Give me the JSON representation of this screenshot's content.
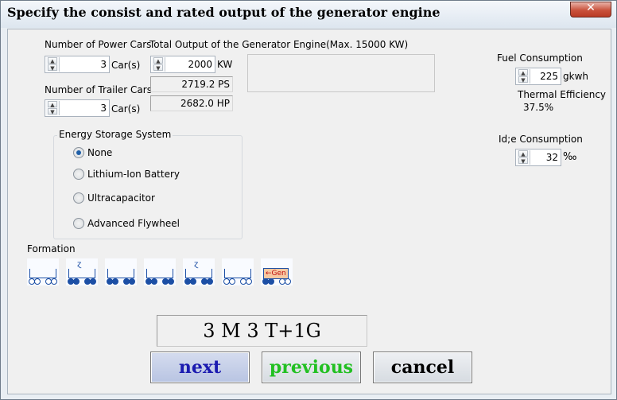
{
  "window": {
    "title": "Specify the consist and rated output of the generator engine",
    "close_glyph": "✕"
  },
  "power_cars": {
    "label": "Number of Power Cars",
    "value": "3",
    "unit": "Car(s)"
  },
  "trailer_cars": {
    "label": "Number of Trailer Cars",
    "value": "3",
    "unit": "Car(s)"
  },
  "total_output": {
    "label": "Total Output of the Generator Engine(Max. 15000 KW)",
    "value": "2000",
    "unit": "KW",
    "ps_value": "2719.2 PS",
    "hp_value": "2682.0 HP"
  },
  "fuel": {
    "label": "Fuel Consumption",
    "value": "225",
    "unit": "gkwh"
  },
  "thermal": {
    "label": "Thermal Efficiency",
    "value": "37.5%"
  },
  "idle": {
    "label": "Id;e Consumption",
    "value": "32",
    "unit": "‰"
  },
  "energy_storage": {
    "legend": "Energy Storage System",
    "options": [
      "None",
      "Lithium-Ion Battery",
      "Ultracapacitor",
      "Advanced Flywheel"
    ],
    "selected": "None"
  },
  "formation": {
    "label": "Formation",
    "cars": [
      "trailer",
      "power",
      "trailer",
      "trailer",
      "power",
      "trailer",
      "generator"
    ],
    "generator_label": "Gen"
  },
  "formula": "3 M 3 T+1G",
  "buttons": {
    "next": "next",
    "previous": "previous",
    "cancel": "cancel"
  },
  "colors": {
    "next": "#1b1bb0",
    "previous": "#22c022",
    "cancel": "#000000",
    "car_blue": "#1c4fa5"
  }
}
